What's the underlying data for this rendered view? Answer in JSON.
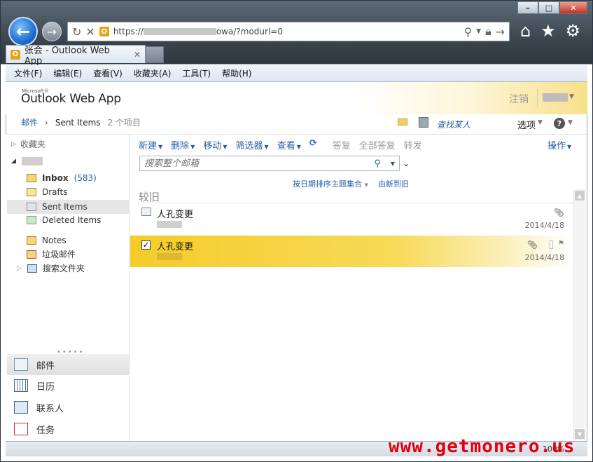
{
  "browser": {
    "url_prefix": "https://",
    "url_suffix": "owa/?modurl=0",
    "tab_title": "张会 - Outlook Web App",
    "tab_close": "✕",
    "window_minimize": "–",
    "window_maximize": "□",
    "window_close": "✕",
    "zoom_level": "100%"
  },
  "menu": [
    "文件(F)",
    "编辑(E)",
    "查看(V)",
    "收藏夹(A)",
    "工具(T)",
    "帮助(H)"
  ],
  "header": {
    "ms_label": "Microsoft®",
    "app_name": "Outlook Web App",
    "sign_out": "注销",
    "find_someone": "查找某人",
    "options": "选项",
    "help": "?"
  },
  "breadcrumb": {
    "mail": "邮件",
    "folder": "Sent Items",
    "count": "2 个项目"
  },
  "leftnav": {
    "favorites": "收藏夹",
    "folders": [
      {
        "label": "Inbox",
        "count": "(583)"
      },
      {
        "label": "Drafts"
      },
      {
        "label": "Sent Items"
      },
      {
        "label": "Deleted Items"
      },
      {
        "label": "Notes"
      },
      {
        "label": "垃圾邮件"
      },
      {
        "label": "搜索文件夹"
      }
    ],
    "splitter": "•••••",
    "modules": [
      "邮件",
      "日历",
      "联系人",
      "任务"
    ]
  },
  "toolbar": {
    "new": "新建",
    "delete": "删除",
    "move": "移动",
    "filter": "筛选器",
    "view": "查看",
    "reply": "答复",
    "reply_all": "全部答复",
    "forward": "转发",
    "actions": "操作"
  },
  "search": {
    "placeholder": "搜索整个邮箱"
  },
  "sort": {
    "arrange_by": "按日期排序主题集合",
    "order": "由新到旧"
  },
  "list": {
    "group_header": "较旧",
    "items": [
      {
        "subject": "人孔变更",
        "date": "2014/4/18"
      },
      {
        "subject": "人孔变更",
        "date": "2014/4/18"
      }
    ]
  },
  "watermark": "www.getmonero.us",
  "colors": {
    "link": "#2a5fa8",
    "selected_item": "#f4cc2a",
    "watermark": "#e00010"
  }
}
